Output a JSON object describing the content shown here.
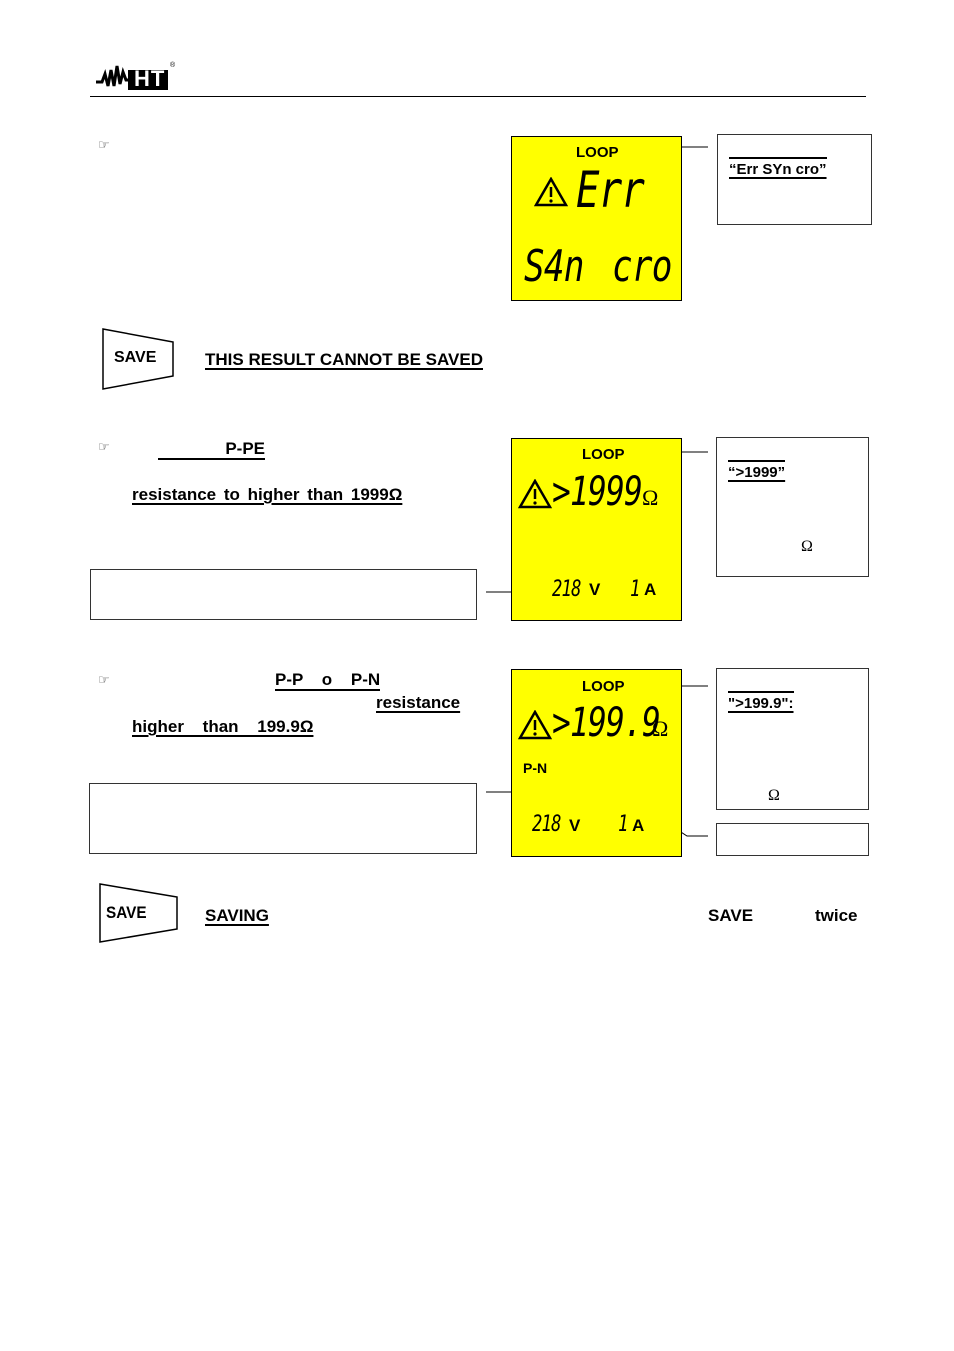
{
  "header": {
    "brand": "HT",
    "brand_mark": "®"
  },
  "section1": {
    "bullet_icon": "pointing-hand-icon",
    "lcd": {
      "label": "LOOP",
      "line1": "Err",
      "line2_a": "S4n",
      "line2_b": "cro"
    },
    "callout": {
      "title": "“Err SYn cro”"
    },
    "save_key": "SAVE",
    "save_note": "THIS RESULT CANNOT BE SAVED"
  },
  "section2": {
    "bullet_icon": "pointing-hand-icon",
    "line1_highlight": "P-PE",
    "line2": "resistance to higher than 1999Ω",
    "lcd": {
      "label": "LOOP",
      "reading": ">1999",
      "unit": "Ω",
      "voltage": "218",
      "voltage_unit": "V",
      "current": "1",
      "current_unit": "A"
    },
    "callout": {
      "title": "“>1999”",
      "unit": "Ω"
    }
  },
  "section3": {
    "bullet_icon": "pointing-hand-icon",
    "line1_a": "P-P",
    "line1_b": "o",
    "line1_c": "P-N",
    "line2": "resistance",
    "line3": "higher than 199.9Ω",
    "lcd": {
      "label": "LOOP",
      "reading": ">199.9",
      "unit": "Ω",
      "mode": "P-N",
      "voltage": "218",
      "voltage_unit": "V",
      "current": "1",
      "current_unit": "A"
    },
    "callout": {
      "title": "\">199.9\":",
      "unit": "Ω"
    }
  },
  "section4": {
    "save_key": "SAVE",
    "heading": "SAVING",
    "key_ref": "SAVE",
    "twice": "twice"
  }
}
